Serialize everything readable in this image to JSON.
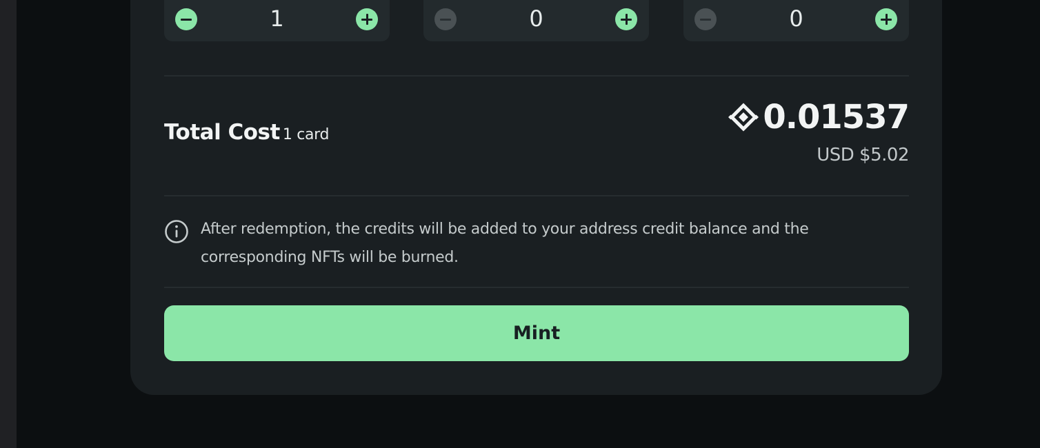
{
  "steppers": [
    {
      "quantity": "1",
      "minus_enabled": true,
      "plus_enabled": true
    },
    {
      "quantity": "0",
      "minus_enabled": false,
      "plus_enabled": true
    },
    {
      "quantity": "0",
      "minus_enabled": false,
      "plus_enabled": true
    }
  ],
  "summary": {
    "total_label": "Total Cost",
    "card_count": "1 card",
    "price": "0.01537",
    "price_icon": "bnb-icon",
    "usd": "USD $5.02"
  },
  "notice": {
    "icon": "info-icon",
    "text": "After redemption, the credits will be added to your address credit balance and the corresponding NFTs will be burned."
  },
  "actions": {
    "mint_label": "Mint"
  },
  "colors": {
    "accent": "#8be6a8",
    "card_bg": "#1a1f22",
    "page_bg": "#0c0f11"
  }
}
